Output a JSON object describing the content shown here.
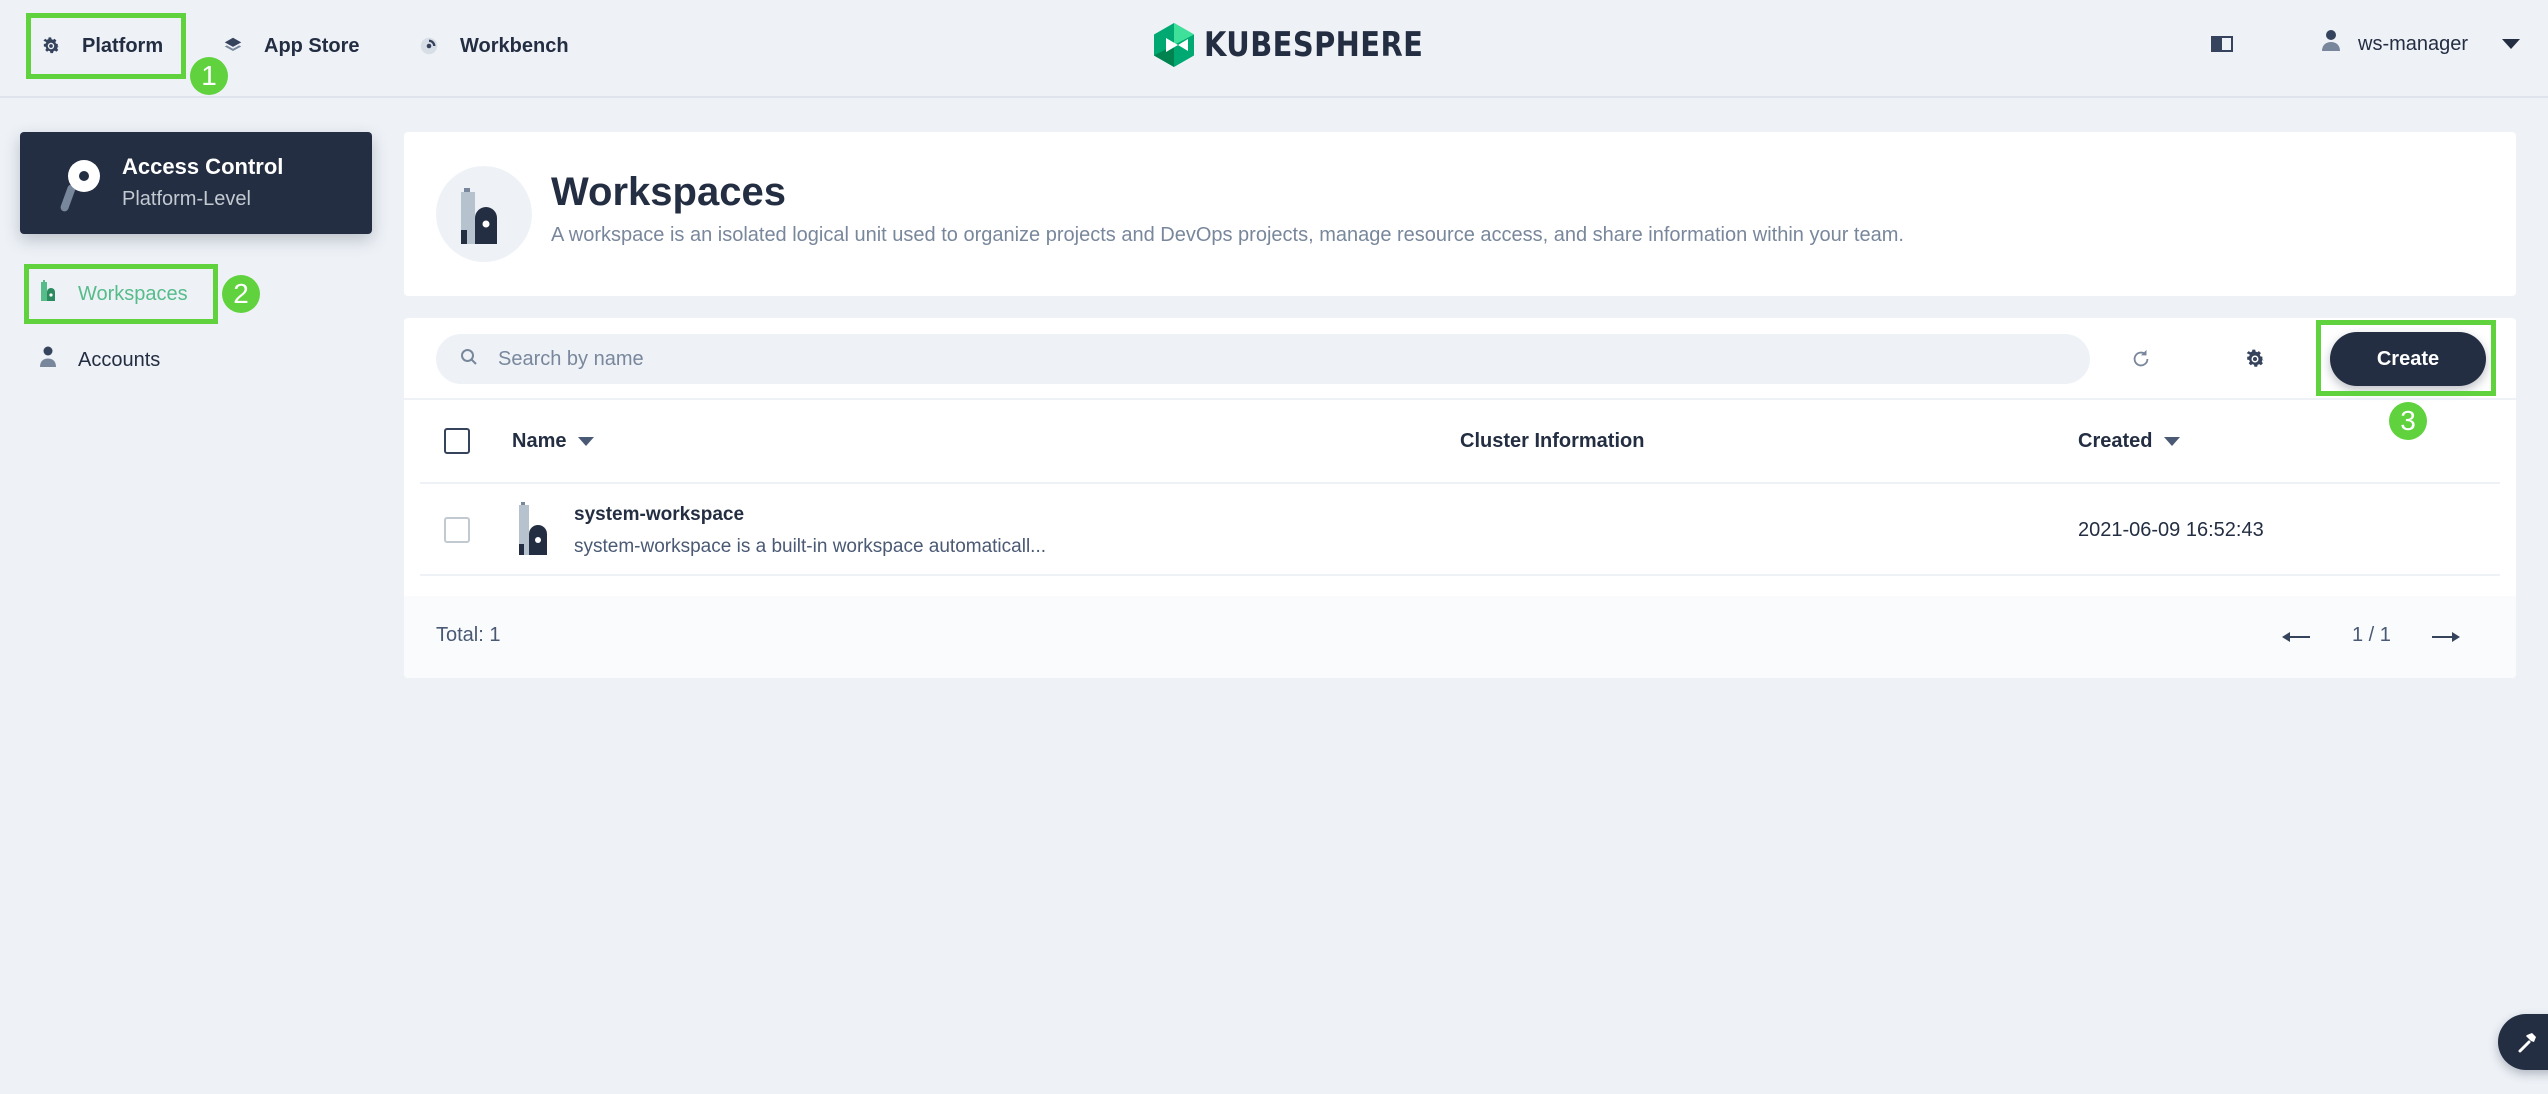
{
  "nav": {
    "items": [
      {
        "label": "Platform",
        "icon": "gear-icon"
      },
      {
        "label": "App Store",
        "icon": "layers-icon"
      },
      {
        "label": "Workbench",
        "icon": "dashboard-icon"
      }
    ],
    "logo_text": "KUBESPHERE",
    "user": "ws-manager"
  },
  "annotations": [
    "1",
    "2",
    "3"
  ],
  "sidebar": {
    "card_title": "Access Control",
    "card_subtitle": "Platform-Level",
    "items": [
      {
        "label": "Workspaces",
        "icon": "workspace-icon",
        "active": true
      },
      {
        "label": "Accounts",
        "icon": "user-icon",
        "active": false
      }
    ]
  },
  "header": {
    "title": "Workspaces",
    "description": "A workspace is an isolated logical unit used to organize projects and DevOps projects, manage resource access, and share information within your team."
  },
  "toolbar": {
    "search_placeholder": "Search by name",
    "create_label": "Create"
  },
  "table": {
    "columns": [
      "Name",
      "Cluster Information",
      "Created"
    ],
    "rows": [
      {
        "name": "system-workspace",
        "description": "system-workspace is a built-in workspace automaticall...",
        "cluster": "",
        "created": "2021-06-09 16:52:43"
      }
    ]
  },
  "footer": {
    "total": "Total: 1",
    "page": "1 / 1"
  },
  "colors": {
    "primary_dark": "#242e42",
    "accent_green": "#55bc8a",
    "annotation_green": "#5fd23d",
    "background": "#eef2f7"
  }
}
